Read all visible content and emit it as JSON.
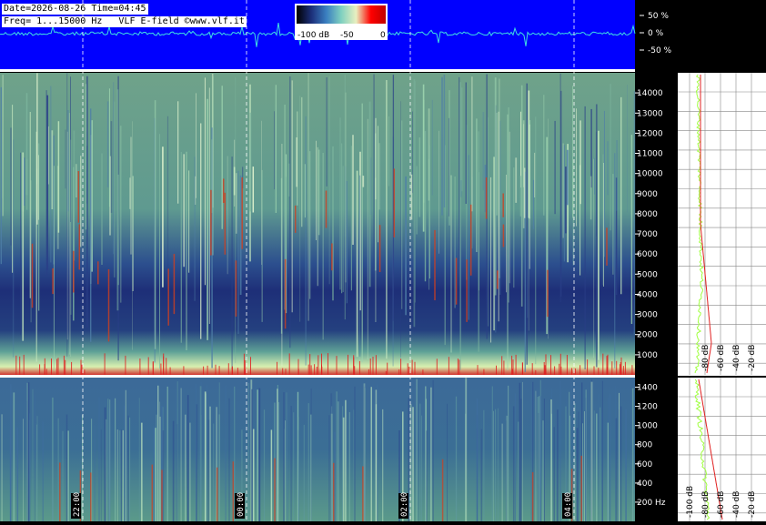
{
  "header": {
    "info_line_1": "Date=2026-08-26 Time=04:45",
    "info_line_2": "Freq= 1...15000 Hz   VLF E-field ©www.vlf.it"
  },
  "colorbar": {
    "labels": [
      "-100 dB",
      "-50",
      "0"
    ],
    "gradient": [
      "#000000",
      "#1c2f7a",
      "#3a7fc0",
      "#7fd0c0",
      "#e8f0c0",
      "#ff0000",
      "#c00000"
    ]
  },
  "waveform_scale": [
    "50 %",
    "0 %",
    "-50 %"
  ],
  "upper_panel": {
    "freq_ticks": [
      "14000",
      "13000",
      "12000",
      "11000",
      "10000",
      "9000",
      "8000",
      "7000",
      "6000",
      "5000",
      "4000",
      "3000",
      "2000",
      "1000"
    ],
    "freq_values": [
      14000,
      13000,
      12000,
      11000,
      10000,
      9000,
      8000,
      7000,
      6000,
      5000,
      4000,
      3000,
      2000,
      1000
    ],
    "freq_max": 15000,
    "db_labels": [
      "-80 dB",
      "-60 dB",
      "-40 dB",
      "-20 dB"
    ]
  },
  "lower_panel": {
    "freq_ticks": [
      "1400",
      "1200",
      "1000",
      "800",
      "600",
      "400",
      "200 Hz"
    ],
    "freq_values": [
      1400,
      1200,
      1000,
      800,
      600,
      400,
      200
    ],
    "freq_max": 1500,
    "db_labels": [
      "-100 dB",
      "-80 dB",
      "-60 dB",
      "-40 dB",
      "-20 dB"
    ]
  },
  "time_labels": [
    "22:00",
    "00:00",
    "02:00",
    "04:00"
  ],
  "colors": {
    "background": "#000000",
    "waveform_bg": "#0000ff",
    "waveform_trace": "#40e0e0",
    "grid_dash": "#ffffff",
    "spectrum_green": "#a0ff40",
    "spectrum_red": "#e02020"
  }
}
